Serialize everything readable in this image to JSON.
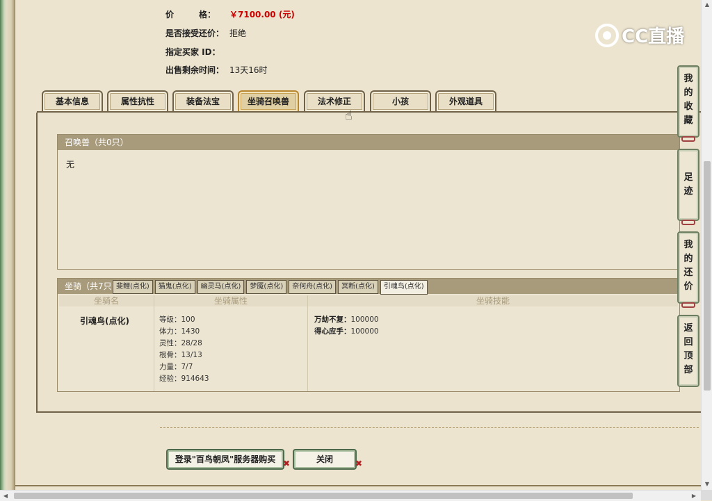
{
  "info": {
    "price_label": "价　　　格：",
    "price_value": "￥7100.00 (元)",
    "counter_label": "是否接受还价：",
    "counter_value": "拒绝",
    "buyer_label": "指定买家 ID：",
    "buyer_value": "",
    "time_label": "出售剩余时间：",
    "time_value": "13天16时"
  },
  "logo": {
    "text": "CC直播"
  },
  "tabs": [
    {
      "label": "基本信息"
    },
    {
      "label": "属性抗性"
    },
    {
      "label": "装备法宝"
    },
    {
      "label": "坐骑召唤兽",
      "active": true
    },
    {
      "label": "法术修正"
    },
    {
      "label": "小孩"
    },
    {
      "label": "外观道具"
    }
  ],
  "summon": {
    "header": "召唤兽（共0只）",
    "body": "无"
  },
  "mounts": {
    "header": "坐骑（共7只",
    "tabs": [
      "斐鲤(点化)",
      "猫鬼(点化)",
      "幽灵马(点化)",
      "梦魇(点化)",
      "奈何舟(点化)",
      "冥断(点化)",
      "引魂鸟(点化)"
    ],
    "active_tab": 6,
    "columns": [
      "坐骑名",
      "坐骑属性",
      "坐骑技能"
    ],
    "selected": {
      "name": "引魂鸟(点化)",
      "attrs": [
        "等级：100",
        "体力：1430",
        "灵性：28/28",
        "根骨：13/13",
        "力量：7/7",
        "经验：914643"
      ],
      "skills": [
        {
          "name": "万劫不复：",
          "value": "100000"
        },
        {
          "name": "得心应手：",
          "value": "100000"
        }
      ]
    }
  },
  "buttons": {
    "login": "登录\"百鸟朝凤\"服务器购买",
    "close": "关闭"
  },
  "side": [
    {
      "label": "我的收藏"
    },
    {
      "label": "足迹"
    },
    {
      "label": "我的还价"
    },
    {
      "label": "返回顶部"
    }
  ]
}
